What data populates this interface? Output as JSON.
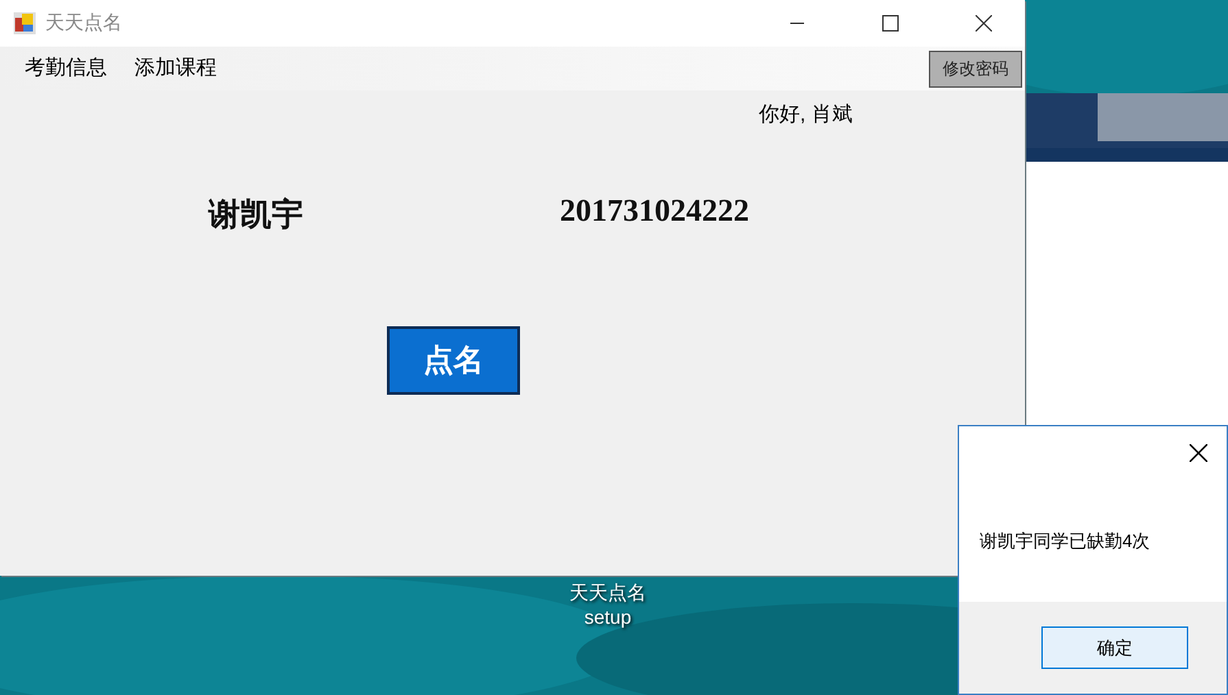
{
  "main_window": {
    "title": "天天点名",
    "menu": [
      {
        "label": "考勤信息"
      },
      {
        "label": "添加课程"
      }
    ],
    "change_password_button": "修改密码",
    "greeting": "你好, 肖斌",
    "student": {
      "name": "谢凯宇",
      "id": "201731024222"
    },
    "roll_call_button": "点名"
  },
  "desktop_icon": {
    "label_lines": [
      "天天点名",
      "setup"
    ]
  },
  "message_box": {
    "message": "谢凯宇同学已缺勤4次",
    "buttons": [
      "确定"
    ]
  }
}
